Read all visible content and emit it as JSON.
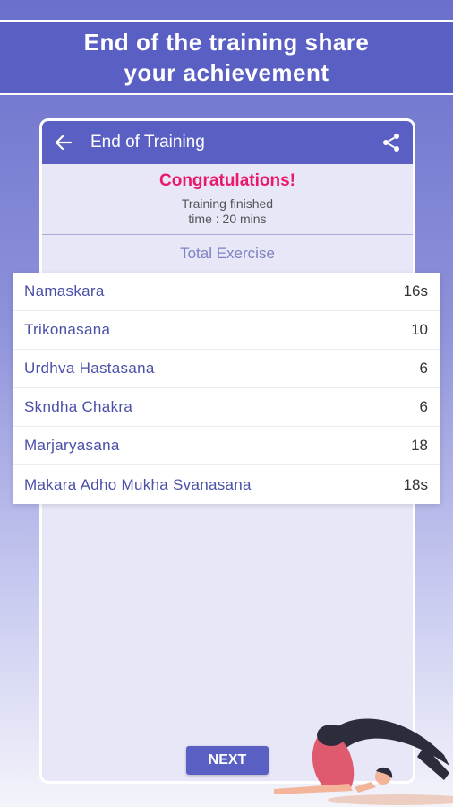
{
  "banner": {
    "text": "End of the training share your achievement"
  },
  "appbar": {
    "title": "End of Training",
    "back_icon": "arrow-left-icon",
    "share_icon": "share-icon"
  },
  "summary": {
    "congrats": "Congratulations!",
    "finished": "Training finished",
    "time": "time : 20 mins",
    "total_label": "Total Exercise"
  },
  "exercises": [
    {
      "name": "Namaskara",
      "value": "16s"
    },
    {
      "name": "Trikonasana",
      "value": "10"
    },
    {
      "name": "Urdhva Hastasana",
      "value": "6"
    },
    {
      "name": "Skndha Chakra",
      "value": "6"
    },
    {
      "name": "Marjaryasana",
      "value": "18"
    },
    {
      "name": "Makara Adho Mukha Svanasana",
      "value": "18s"
    }
  ],
  "next_label": "NEXT",
  "colors": {
    "primary": "#5a5fc4",
    "accent": "#e9196b",
    "card_bg": "#e7e7f8"
  }
}
